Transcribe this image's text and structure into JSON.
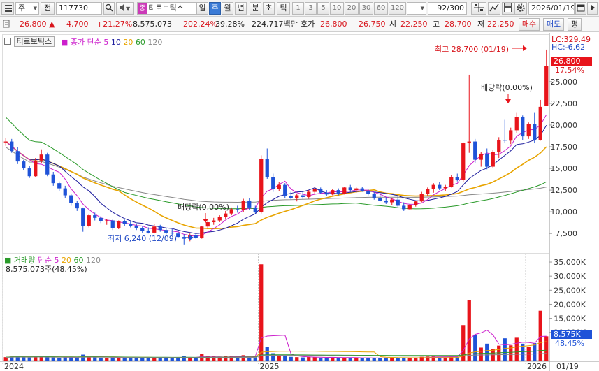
{
  "toolbar": {
    "market_type": "주",
    "mode_label": "전",
    "stock_code": "117730",
    "stock_name_badge": "종",
    "stock_name": "티로보틱스",
    "periods": [
      "일",
      "주",
      "월",
      "년",
      "분",
      "초",
      "틱"
    ],
    "active_period": "주",
    "intervals": [
      "1",
      "3",
      "5",
      "10",
      "20",
      "30",
      "60",
      "120"
    ],
    "count_display": "92/300",
    "date": "2026/01/19"
  },
  "quote": {
    "price": "26,800",
    "change": "4,700",
    "change_rate": "+21.27%",
    "volume": "8,575,073",
    "volume_ratio": "202.24%",
    "turnover_ratio": "39.28%",
    "trade_value": "224,717백만",
    "ask_label": "호가",
    "ask1": "26,800",
    "ask2": "26,750",
    "open_label": "시",
    "open": "22,250",
    "high_label": "고",
    "high": "28,700",
    "low_label": "저",
    "low": "22,250",
    "buy_button": "매수",
    "sell_button": "매도",
    "eval_button": "평"
  },
  "colors": {
    "up": "#e8141b",
    "down": "#1f53d8",
    "ma5": "#cc1fcc",
    "ma10": "#1d1d9e",
    "ma20": "#e8a400",
    "ma60": "#2a9a2a",
    "ma120": "#888888",
    "current_tag": "#e8141b"
  },
  "price_panel": {
    "tab_name": "티로보틱스",
    "legend": {
      "label": "종가 단순",
      "periods": [
        "5",
        "10",
        "20",
        "60",
        "120"
      ]
    },
    "lc": "LC:329.49",
    "hc": "HC:-6.62",
    "current_price_tag": "26,800",
    "current_rate_tag": "17.54%",
    "high_annotation": "최고 28,700 (01/19)",
    "low_annotation": "최저 6,240 (12/09)",
    "dividend_annotations": [
      "배당락(0.00%)",
      "배당락(0.00%)"
    ],
    "y_ticks": [
      "7,500",
      "10,000",
      "12,500",
      "15,000",
      "17,500",
      "20,000",
      "22,500",
      "25,000"
    ]
  },
  "volume_panel": {
    "legend": {
      "label": "거래량",
      "sub": "단순",
      "periods": [
        "5",
        "20",
        "60",
        "120"
      ]
    },
    "current_volume": "8,575,073주(48.45%)",
    "current_tag": "8,575K",
    "current_rate_tag": "48.45%",
    "y_ticks": [
      "10,000K",
      "15,000K",
      "20,000K",
      "25,000K",
      "30,000K",
      "35,000K"
    ]
  },
  "x_axis": {
    "labels": [
      "2024",
      "2025",
      "2026",
      "01/19"
    ]
  },
  "chart_data": {
    "type": "candlestick",
    "unit": "KRW",
    "price_ylim": [
      5500,
      29500
    ],
    "volume_ylim": [
      0,
      36000000
    ],
    "candles": [
      [
        18000,
        18500,
        17600,
        18100
      ],
      [
        18100,
        18400,
        16800,
        17000
      ],
      [
        17000,
        17500,
        15500,
        15800
      ],
      [
        15800,
        16000,
        14800,
        15000
      ],
      [
        15000,
        15300,
        13900,
        14100
      ],
      [
        14100,
        16200,
        14000,
        15900
      ],
      [
        15900,
        17200,
        15600,
        16600
      ],
      [
        16600,
        16800,
        14100,
        14300
      ],
      [
        14300,
        14600,
        13000,
        13300
      ],
      [
        13300,
        13500,
        12400,
        12700
      ],
      [
        12700,
        13000,
        11600,
        11900
      ],
      [
        11900,
        12100,
        10700,
        11000
      ],
      [
        11000,
        11300,
        10100,
        10400
      ],
      [
        10400,
        10500,
        7700,
        8400
      ],
      [
        8400,
        9700,
        8200,
        9600
      ],
      [
        9600,
        9900,
        9000,
        9300
      ],
      [
        9300,
        9500,
        8700,
        8900
      ],
      [
        8900,
        9200,
        8500,
        9000
      ],
      [
        9000,
        9100,
        7900,
        8100
      ],
      [
        8100,
        9000,
        8000,
        8900
      ],
      [
        8900,
        9100,
        8400,
        8600
      ],
      [
        8600,
        8900,
        8200,
        8400
      ],
      [
        8400,
        8600,
        7900,
        8100
      ],
      [
        8100,
        8300,
        7600,
        7800
      ],
      [
        7800,
        8200,
        7500,
        7600
      ],
      [
        7600,
        8600,
        7500,
        8300
      ],
      [
        8300,
        8500,
        7700,
        7900
      ],
      [
        7900,
        8100,
        7400,
        7600
      ],
      [
        7600,
        8000,
        7300,
        7500
      ],
      [
        7500,
        7800,
        7000,
        7100
      ],
      [
        7100,
        7400,
        6240,
        6900
      ],
      [
        6900,
        7500,
        6600,
        7300
      ],
      [
        7300,
        7500,
        6900,
        7000
      ],
      [
        7000,
        8400,
        6900,
        8300
      ],
      [
        8300,
        9100,
        8000,
        8800
      ],
      [
        8800,
        9300,
        8500,
        9000
      ],
      [
        9000,
        9600,
        8800,
        9400
      ],
      [
        9400,
        10100,
        9200,
        9800
      ],
      [
        9800,
        10500,
        9600,
        10300
      ],
      [
        10300,
        10700,
        9900,
        10200
      ],
      [
        10200,
        11500,
        10000,
        11300
      ],
      [
        11300,
        11600,
        10200,
        10500
      ],
      [
        10500,
        10700,
        9800,
        10000
      ],
      [
        10000,
        16500,
        9800,
        16100
      ],
      [
        16100,
        17300,
        13800,
        14000
      ],
      [
        14000,
        14400,
        12300,
        12600
      ],
      [
        12600,
        13400,
        12400,
        13100
      ],
      [
        13100,
        13300,
        11600,
        11800
      ],
      [
        11800,
        12300,
        11400,
        11600
      ],
      [
        11600,
        12100,
        11200,
        11900
      ],
      [
        11900,
        12300,
        11500,
        11700
      ],
      [
        11700,
        12500,
        11500,
        12300
      ],
      [
        12300,
        12900,
        12000,
        12600
      ],
      [
        12600,
        12800,
        12100,
        12200
      ],
      [
        12200,
        12500,
        11800,
        12000
      ],
      [
        12000,
        12600,
        11900,
        12500
      ],
      [
        12500,
        12700,
        11900,
        12100
      ],
      [
        12100,
        12900,
        12000,
        12800
      ],
      [
        12800,
        13100,
        12300,
        12500
      ],
      [
        12500,
        12800,
        12200,
        12700
      ],
      [
        12700,
        12900,
        12300,
        12400
      ],
      [
        12400,
        12600,
        11900,
        12100
      ],
      [
        12100,
        12300,
        11400,
        11600
      ],
      [
        11600,
        12000,
        11200,
        11300
      ],
      [
        11300,
        11700,
        10900,
        11100
      ],
      [
        11100,
        11600,
        10800,
        11400
      ],
      [
        11400,
        11900,
        10600,
        10700
      ],
      [
        10700,
        11100,
        10100,
        10300
      ],
      [
        10300,
        10900,
        10200,
        10800
      ],
      [
        10800,
        11300,
        10600,
        11200
      ],
      [
        11200,
        12300,
        11100,
        12100
      ],
      [
        12100,
        12800,
        11800,
        12600
      ],
      [
        12600,
        13300,
        12200,
        13100
      ],
      [
        13100,
        13400,
        12500,
        12700
      ],
      [
        12700,
        13100,
        12400,
        12900
      ],
      [
        12900,
        14200,
        12800,
        14000
      ],
      [
        14000,
        14400,
        13500,
        13700
      ],
      [
        13700,
        18000,
        13400,
        17900
      ],
      [
        17900,
        25800,
        16800,
        18100
      ],
      [
        18100,
        18400,
        15600,
        16000
      ],
      [
        16000,
        16900,
        15200,
        16700
      ],
      [
        16700,
        17300,
        14900,
        15200
      ],
      [
        15200,
        17100,
        15000,
        16900
      ],
      [
        16900,
        18600,
        16200,
        18300
      ],
      [
        18300,
        20600,
        17900,
        18200
      ],
      [
        18200,
        19700,
        17800,
        19400
      ],
      [
        19400,
        21400,
        19100,
        20900
      ],
      [
        20900,
        21100,
        18300,
        18700
      ],
      [
        18700,
        20300,
        18400,
        20100
      ],
      [
        20100,
        21400,
        17900,
        18300
      ],
      [
        18300,
        22900,
        18200,
        22100
      ],
      [
        22250,
        28700,
        22250,
        26800
      ]
    ],
    "volume": [
      1.2,
      1.4,
      1.5,
      1.3,
      1.1,
      1.7,
      1.5,
      1.2,
      1.1,
      1.0,
      1.2,
      1.3,
      1.1,
      2.1,
      1.4,
      1.2,
      1.0,
      0.9,
      1.1,
      1.0,
      0.9,
      0.8,
      0.9,
      0.8,
      0.9,
      1.1,
      0.9,
      0.8,
      0.9,
      1.0,
      1.5,
      1.2,
      1.0,
      2.3,
      1.6,
      1.4,
      1.3,
      1.5,
      1.6,
      1.3,
      1.9,
      1.4,
      1.1,
      34.2,
      4.8,
      2.6,
      1.9,
      1.5,
      1.3,
      1.2,
      1.1,
      1.3,
      1.2,
      1.0,
      1.0,
      1.2,
      1.0,
      1.1,
      1.0,
      0.9,
      0.9,
      1.0,
      0.9,
      0.8,
      0.9,
      1.0,
      0.8,
      0.9,
      0.9,
      1.0,
      1.3,
      1.4,
      1.5,
      1.1,
      1.0,
      1.8,
      1.3,
      12.6,
      21.5,
      9.2,
      4.6,
      6.0,
      4.1,
      5.3,
      7.9,
      5.4,
      8.1,
      6.0,
      4.8,
      6.2,
      17.7,
      8.6
    ],
    "volume_unit": "millions of shares",
    "moving_averages": [
      "5",
      "10",
      "20",
      "60",
      "120"
    ]
  }
}
